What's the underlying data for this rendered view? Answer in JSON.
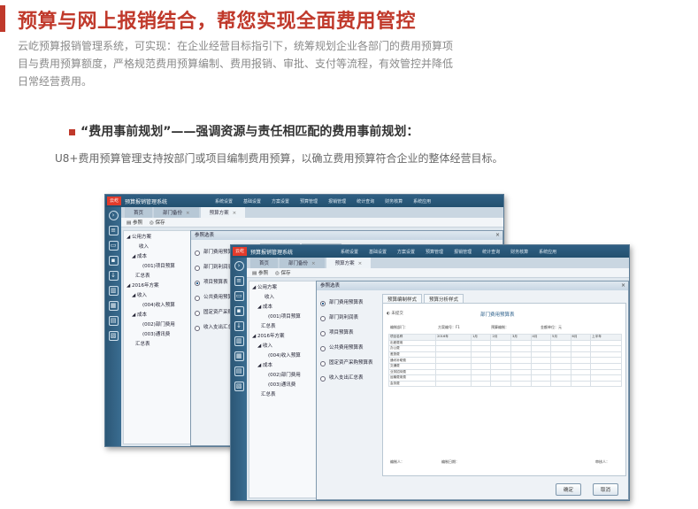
{
  "header": {
    "title": "预算与网上报销结合，帮您实现全面费用管控",
    "intro": "云屹预算报销管理系统，可实现：在企业经营目标指引下，统筹规划企业各部门的费用预算项目与费用预算额度，严格规范费用预算编制、费用报销、审批、支付等流程，有效管控并降低日常经营费用。"
  },
  "section": {
    "heading": "“费用事前规划”——强调资源与责任相匹配的费用事前规划：",
    "desc": "U8+费用预算管理支持按部门或项目编制费用预算，以确立费用预算符合企业的整体经营目标。"
  },
  "app": {
    "logo": "云屹",
    "name": "预算报销管理系统",
    "menu": [
      "系统设置",
      "基础设置",
      "方案设置",
      "预算管理",
      "报销管理",
      "统计查询",
      "财务核算",
      "系统应用"
    ],
    "tabs": [
      "首页",
      "部门备份",
      "预算方案"
    ],
    "toolbar": {
      "params": "参照",
      "save": "保存"
    }
  },
  "tree": [
    "公用方案",
    "收入",
    "成本",
    "(001)项目预算",
    "汇总表",
    "2016年方案",
    "收入",
    "(004)收入预算",
    "成本",
    "(002)部门费用",
    "(003)通讯费",
    "汇总表"
  ],
  "dialog": {
    "title": "参照选表",
    "options": [
      "部门费用预算表",
      "部门到利润表",
      "项目预算表",
      "公共费用预算表",
      "固定资产采购预算表",
      "收入支出汇总表"
    ],
    "selected_index": 0,
    "subtabs": [
      "预算编制样式",
      "预算分析样式"
    ],
    "preview": {
      "tag": "未提交",
      "title": "部门费用预算表",
      "info": [
        "编制部门：",
        "方案编号：F1",
        "预算编制：",
        "金额单位：元"
      ],
      "head_row": [
        "项目名称",
        "2016年",
        "1月",
        "2月",
        "3月",
        "4月",
        "5月",
        "6月",
        "上半年"
      ],
      "rows": [
        "出差费用",
        "办公费",
        "差旅费",
        "通讯补助费",
        "交通费",
        "业务招待费",
        "运输费用费",
        "会务费"
      ],
      "footer": [
        "编制人：",
        "编制日期：",
        "审核人："
      ]
    },
    "ok": "确定",
    "cancel": "取消"
  }
}
